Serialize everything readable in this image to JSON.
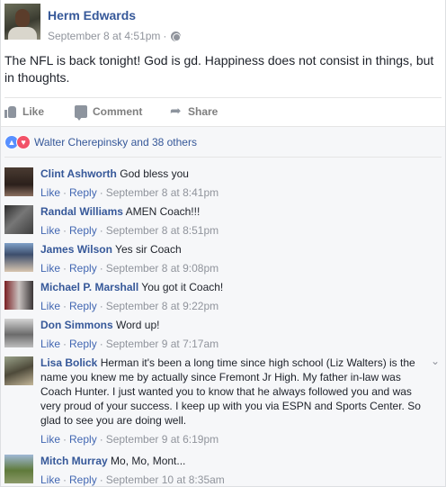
{
  "post": {
    "author": "Herm Edwards",
    "timestamp": "September 8 at 4:51pm",
    "meta_dot": "·",
    "text": "The NFL is back tonight! God is gd. Happiness does not consist in things, but in thoughts."
  },
  "actions": {
    "like_label": "Like",
    "comment_label": "Comment",
    "share_label": "Share"
  },
  "reactions": {
    "summary": "Walter Cherepinsky and 38 others"
  },
  "comment_labels": {
    "like": "Like",
    "reply": "Reply",
    "sep": "·"
  },
  "comments": [
    {
      "name": "Clint Ashworth",
      "text": "God bless you",
      "time": "September 8 at 8:41pm"
    },
    {
      "name": "Randal Williams",
      "text": "AMEN Coach!!!",
      "time": "September 8 at 8:51pm"
    },
    {
      "name": "James Wilson",
      "text": "Yes sir Coach",
      "time": "September 8 at 9:08pm"
    },
    {
      "name": "Michael P. Marshall",
      "text": "You got it Coach!",
      "time": "September 8 at 9:22pm"
    },
    {
      "name": "Don Simmons",
      "text": "Word up!",
      "time": "September 9 at 7:17am"
    },
    {
      "name": "Lisa Bolick",
      "text": "Herman it's been a long time since high school (Liz Walters) is the name you knew me by actually since Fremont Jr High. My father in-law was Coach Hunter. I just wanted you to know that he always followed you and was very proud of your success. I keep up with you via ESPN and Sports Center. So glad to see you are doing well.",
      "time": "September 9 at 6:19pm"
    },
    {
      "name": "Mitch Murray",
      "text": "Mo, Mo, Mont...",
      "time": "September 10 at 8:35am"
    }
  ]
}
